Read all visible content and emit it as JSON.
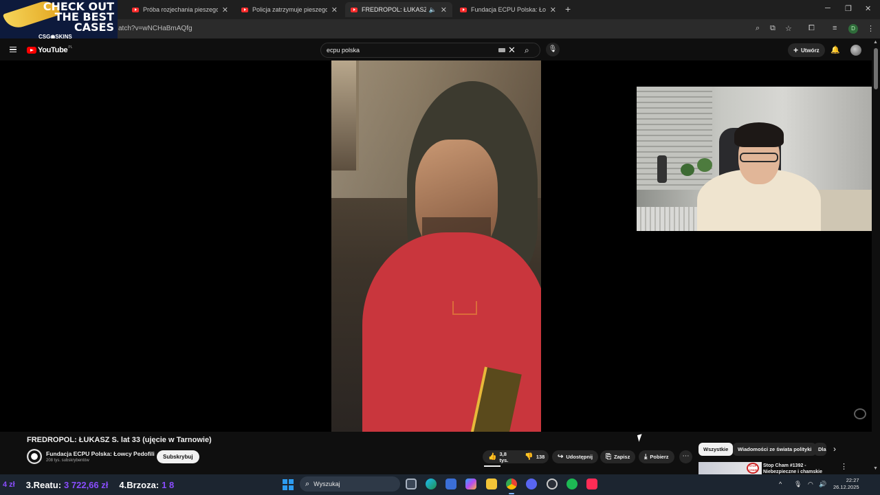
{
  "browser": {
    "tabs": [
      {
        "title": "Próba rozjechania pieszego (Ba",
        "active": false
      },
      {
        "title": "Policja zatrzymuje pieszego na",
        "active": false
      },
      {
        "title": "FREDROPOL: ŁUKASZ S. lat",
        "active": true
      },
      {
        "title": "Fundacja ECPU Polska: Łowcy P",
        "active": false
      }
    ],
    "url": "atch?v=wNCHaBmAQfg",
    "profile_letter": "D"
  },
  "ad": {
    "line1": "CHECK OUT",
    "line2": "THE BEST",
    "line3": "CASES",
    "brand": "CSG◉SKINS"
  },
  "youtube": {
    "logo_text": "YouTube",
    "logo_region": "PL",
    "search_value": "ecpu polska",
    "create_label": "Utwórz"
  },
  "video": {
    "title": "FREDROPOL: ŁUKASZ S. lat 33 (ujęcie w Tarnowie)",
    "channel_name": "Fundacja ECPU Polska: Łowcy Pedofili",
    "channel_subs": "208 tys. subskrybentów",
    "subscribe_label": "Subskrybuj",
    "likes": "3,8 tys.",
    "dislikes": "138",
    "share_label": "Udostępnij",
    "save_label": "Zapisz",
    "download_label": "Pobierz"
  },
  "chips": [
    "Wszystkie",
    "Wiadomości ze świata polityki",
    "Dla"
  ],
  "recommendation": {
    "badge": "STOP CHAM",
    "title_line1": "Stop Cham #1392 -",
    "title_line2": "Niebezpieczne i chamskie"
  },
  "ticker": {
    "prefix_value": "4 zł",
    "item3_label": "3.Reatu:",
    "item3_value": "3 722,66 zł",
    "item4_label": "4.Brzoza:",
    "item4_value": "1 8"
  },
  "taskbar": {
    "search_placeholder": "Wyszukaj",
    "time": "22:27",
    "date": "26.12.2025"
  }
}
